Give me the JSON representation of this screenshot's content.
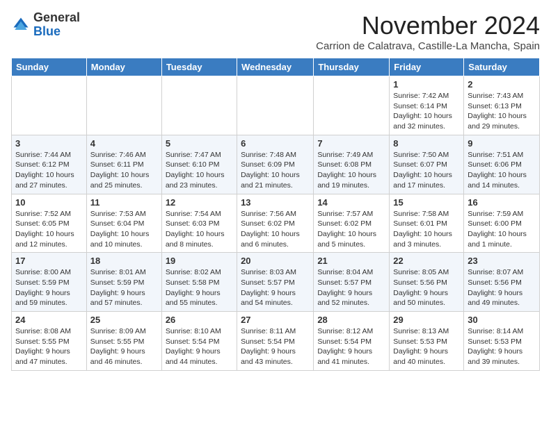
{
  "logo": {
    "general": "General",
    "blue": "Blue"
  },
  "header": {
    "month": "November 2024",
    "location": "Carrion de Calatrava, Castille-La Mancha, Spain"
  },
  "weekdays": [
    "Sunday",
    "Monday",
    "Tuesday",
    "Wednesday",
    "Thursday",
    "Friday",
    "Saturday"
  ],
  "weeks": [
    [
      {
        "day": "",
        "info": ""
      },
      {
        "day": "",
        "info": ""
      },
      {
        "day": "",
        "info": ""
      },
      {
        "day": "",
        "info": ""
      },
      {
        "day": "",
        "info": ""
      },
      {
        "day": "1",
        "info": "Sunrise: 7:42 AM\nSunset: 6:14 PM\nDaylight: 10 hours\nand 32 minutes."
      },
      {
        "day": "2",
        "info": "Sunrise: 7:43 AM\nSunset: 6:13 PM\nDaylight: 10 hours\nand 29 minutes."
      }
    ],
    [
      {
        "day": "3",
        "info": "Sunrise: 7:44 AM\nSunset: 6:12 PM\nDaylight: 10 hours\nand 27 minutes."
      },
      {
        "day": "4",
        "info": "Sunrise: 7:46 AM\nSunset: 6:11 PM\nDaylight: 10 hours\nand 25 minutes."
      },
      {
        "day": "5",
        "info": "Sunrise: 7:47 AM\nSunset: 6:10 PM\nDaylight: 10 hours\nand 23 minutes."
      },
      {
        "day": "6",
        "info": "Sunrise: 7:48 AM\nSunset: 6:09 PM\nDaylight: 10 hours\nand 21 minutes."
      },
      {
        "day": "7",
        "info": "Sunrise: 7:49 AM\nSunset: 6:08 PM\nDaylight: 10 hours\nand 19 minutes."
      },
      {
        "day": "8",
        "info": "Sunrise: 7:50 AM\nSunset: 6:07 PM\nDaylight: 10 hours\nand 17 minutes."
      },
      {
        "day": "9",
        "info": "Sunrise: 7:51 AM\nSunset: 6:06 PM\nDaylight: 10 hours\nand 14 minutes."
      }
    ],
    [
      {
        "day": "10",
        "info": "Sunrise: 7:52 AM\nSunset: 6:05 PM\nDaylight: 10 hours\nand 12 minutes."
      },
      {
        "day": "11",
        "info": "Sunrise: 7:53 AM\nSunset: 6:04 PM\nDaylight: 10 hours\nand 10 minutes."
      },
      {
        "day": "12",
        "info": "Sunrise: 7:54 AM\nSunset: 6:03 PM\nDaylight: 10 hours\nand 8 minutes."
      },
      {
        "day": "13",
        "info": "Sunrise: 7:56 AM\nSunset: 6:02 PM\nDaylight: 10 hours\nand 6 minutes."
      },
      {
        "day": "14",
        "info": "Sunrise: 7:57 AM\nSunset: 6:02 PM\nDaylight: 10 hours\nand 5 minutes."
      },
      {
        "day": "15",
        "info": "Sunrise: 7:58 AM\nSunset: 6:01 PM\nDaylight: 10 hours\nand 3 minutes."
      },
      {
        "day": "16",
        "info": "Sunrise: 7:59 AM\nSunset: 6:00 PM\nDaylight: 10 hours\nand 1 minute."
      }
    ],
    [
      {
        "day": "17",
        "info": "Sunrise: 8:00 AM\nSunset: 5:59 PM\nDaylight: 9 hours\nand 59 minutes."
      },
      {
        "day": "18",
        "info": "Sunrise: 8:01 AM\nSunset: 5:59 PM\nDaylight: 9 hours\nand 57 minutes."
      },
      {
        "day": "19",
        "info": "Sunrise: 8:02 AM\nSunset: 5:58 PM\nDaylight: 9 hours\nand 55 minutes."
      },
      {
        "day": "20",
        "info": "Sunrise: 8:03 AM\nSunset: 5:57 PM\nDaylight: 9 hours\nand 54 minutes."
      },
      {
        "day": "21",
        "info": "Sunrise: 8:04 AM\nSunset: 5:57 PM\nDaylight: 9 hours\nand 52 minutes."
      },
      {
        "day": "22",
        "info": "Sunrise: 8:05 AM\nSunset: 5:56 PM\nDaylight: 9 hours\nand 50 minutes."
      },
      {
        "day": "23",
        "info": "Sunrise: 8:07 AM\nSunset: 5:56 PM\nDaylight: 9 hours\nand 49 minutes."
      }
    ],
    [
      {
        "day": "24",
        "info": "Sunrise: 8:08 AM\nSunset: 5:55 PM\nDaylight: 9 hours\nand 47 minutes."
      },
      {
        "day": "25",
        "info": "Sunrise: 8:09 AM\nSunset: 5:55 PM\nDaylight: 9 hours\nand 46 minutes."
      },
      {
        "day": "26",
        "info": "Sunrise: 8:10 AM\nSunset: 5:54 PM\nDaylight: 9 hours\nand 44 minutes."
      },
      {
        "day": "27",
        "info": "Sunrise: 8:11 AM\nSunset: 5:54 PM\nDaylight: 9 hours\nand 43 minutes."
      },
      {
        "day": "28",
        "info": "Sunrise: 8:12 AM\nSunset: 5:54 PM\nDaylight: 9 hours\nand 41 minutes."
      },
      {
        "day": "29",
        "info": "Sunrise: 8:13 AM\nSunset: 5:53 PM\nDaylight: 9 hours\nand 40 minutes."
      },
      {
        "day": "30",
        "info": "Sunrise: 8:14 AM\nSunset: 5:53 PM\nDaylight: 9 hours\nand 39 minutes."
      }
    ]
  ]
}
